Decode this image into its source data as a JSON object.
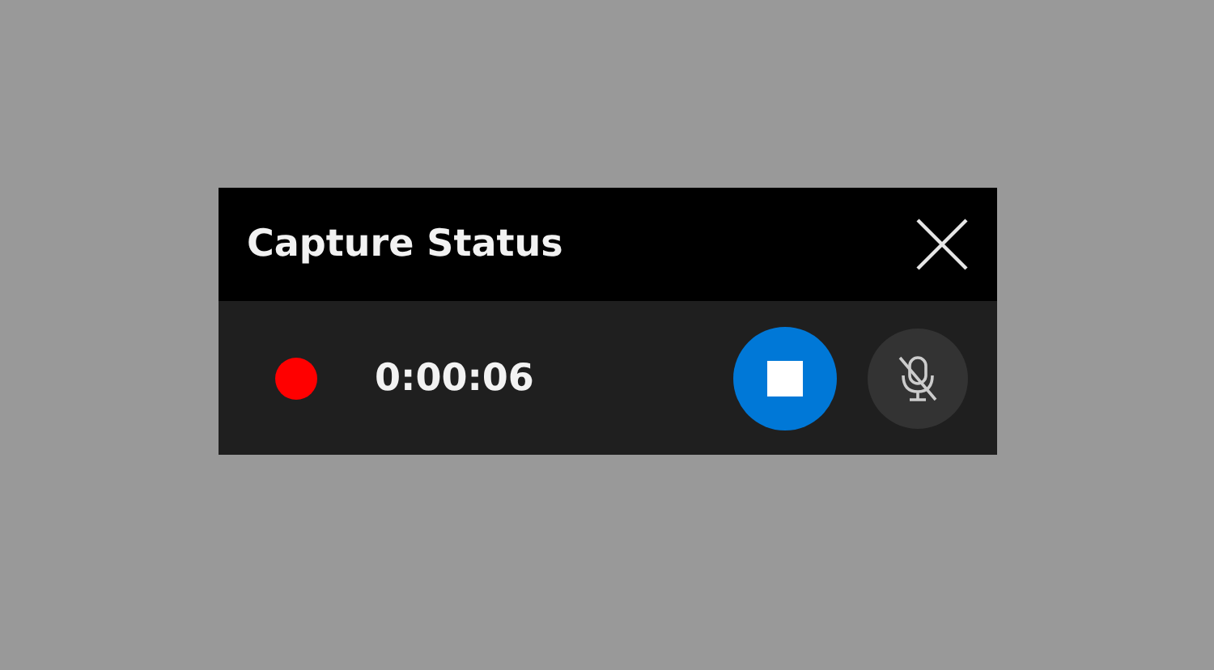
{
  "window": {
    "title": "Capture Status"
  },
  "status": {
    "recording": true,
    "elapsed": "0:00:06"
  },
  "microphone": {
    "muted": true
  }
}
